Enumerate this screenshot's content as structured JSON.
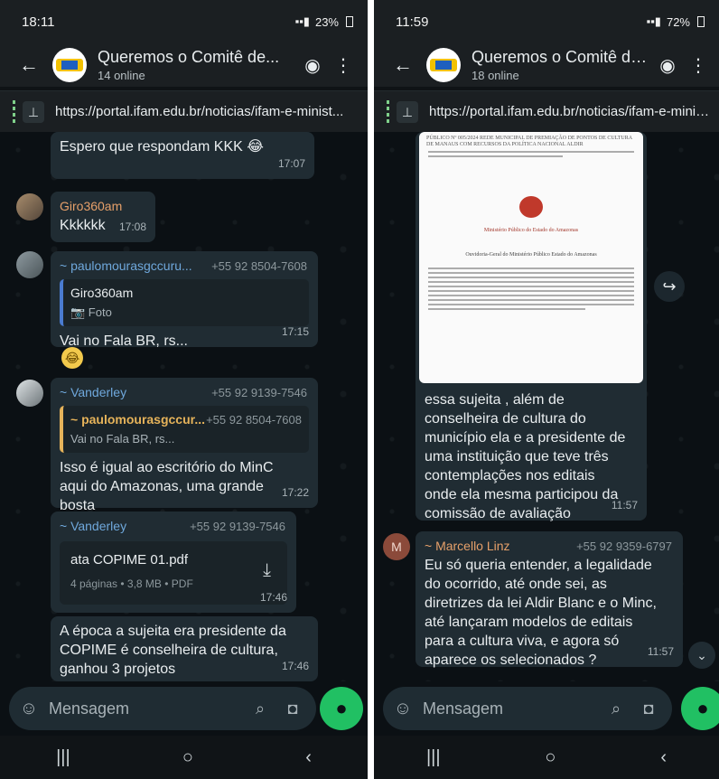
{
  "left": {
    "status": {
      "time": "18:11",
      "battery": "23%"
    },
    "header": {
      "title": "Queremos o Comitê de...",
      "subtitle": "14 online"
    },
    "pinned_link": "https://portal.ifam.edu.br/noticias/ifam-e-minist...",
    "messages": {
      "m1": {
        "text": "Espero que respondam KKK 😂",
        "time": "17:07"
      },
      "m2": {
        "sender": "Giro360am",
        "text": "Kkkkkk",
        "time": "17:08"
      },
      "m3": {
        "sender": "~ paulomourasgccuru...",
        "phone": "+55 92 8504-7608",
        "quote_name": "Giro360am",
        "quote_text": "📷 Foto",
        "text": "Vai no Fala BR, rs...",
        "time": "17:15",
        "reaction": "😂"
      },
      "m4": {
        "sender": "~ Vanderley",
        "phone": "+55 92 9139-7546",
        "quote_name": "~ paulomourasgccur...",
        "quote_phone": "+55 92 8504-7608",
        "quote_text": "Vai no Fala BR, rs...",
        "text": "Isso é igual ao escritório do MinC aqui do Amazonas, uma grande bosta",
        "time": "17:22"
      },
      "m5": {
        "sender": "~ Vanderley",
        "phone": "+55 92 9139-7546",
        "file_name": "ata COPIME 01.pdf",
        "file_meta": "4 páginas • 3,8 MB • PDF",
        "time": "17:46"
      },
      "m6": {
        "text": "A época a sujeita era presidente da COPIME é conselheira de cultura, ganhou 3 projetos",
        "time": "17:46"
      }
    },
    "composer_placeholder": "Mensagem"
  },
  "right": {
    "status": {
      "time": "11:59",
      "battery": "72%"
    },
    "header": {
      "title": "Queremos o Comitê de...",
      "subtitle": "18 online"
    },
    "pinned_link": "https://portal.ifam.edu.br/noticias/ifam-e-minist...",
    "doc": {
      "top_text": "PÚBLICO Nº 005/2024 REDE MUNICIPAL DE PREMIAÇÃO DE PONTOS DE CULTURA DE MANAUS COM RECURSOS DA POLÍTICA NACIONAL ALDIR",
      "agency": "Ministério Público do Estado do Amazonas",
      "body": "Ouvidoria-Geral do Ministério Público Estado do Amazonas"
    },
    "messages": {
      "m1": {
        "text": "essa sujeita , além de conselheira de cultura do município ela  e a presidente de uma instituição que teve  três contemplações  nos editais onde ela mesma participou da comissão de avaliação",
        "time": "11:57"
      },
      "m2": {
        "avatar_letter": "M",
        "sender": "~ Marcello Linz",
        "phone": "+55 92 9359-6797",
        "text": "Eu só queria entender, a legalidade do ocorrido, até onde sei, as diretrizes da lei Aldir Blanc e o Minc, até lançaram modelos de editais para a cultura viva, e agora só aparece os selecionados ?",
        "time": "11:57"
      }
    },
    "composer_placeholder": "Mensagem"
  },
  "icons": {
    "back": "←",
    "status": "status-icon",
    "more": "⋮",
    "pin": "pin-icon",
    "attach": "attach-icon",
    "camera": "camera-icon",
    "mic": "mic-icon",
    "forward": "forward-icon"
  }
}
